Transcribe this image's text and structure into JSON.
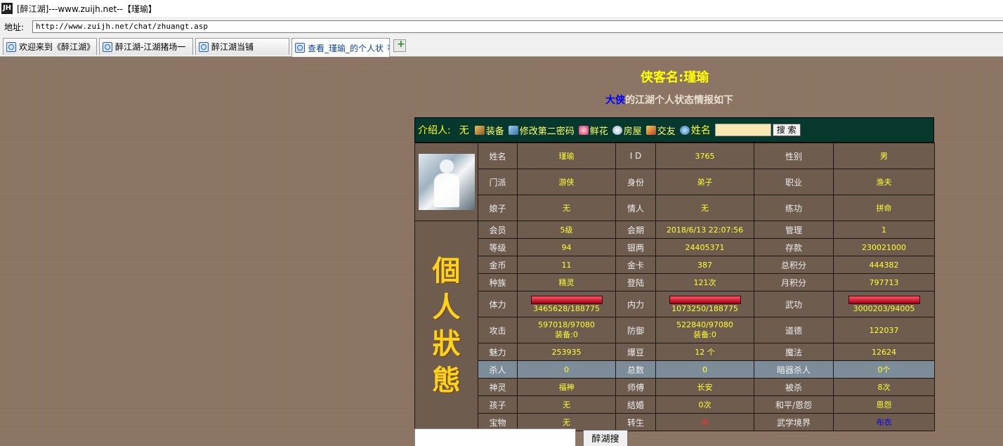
{
  "window": {
    "title": "[醉江湖]---www.zuijh.net--【瑾瑜】",
    "logo": "zuijh-logo"
  },
  "address": {
    "label": "地址:",
    "url": "http://www.zuijh.net/chat/zhuangt.asp"
  },
  "tabs": [
    {
      "label": "欢迎来到《醉江湖》"
    },
    {
      "label": "醉江湖-江湖猪场一"
    },
    {
      "label": "醉江湖当铺"
    },
    {
      "label": "查看_瑾瑜_的个人状"
    }
  ],
  "page": {
    "hero_name": "侠客名:瑾瑜",
    "subtitle_highlight": "大侠",
    "subtitle_rest": "的江湖个人状态情报如下",
    "toolbar": {
      "intro_label": "介绍人:",
      "intro_value": "无",
      "equip": "装备",
      "change_pwd": "修改第二密码",
      "flower": "鲜花",
      "house": "房屋",
      "friend": "交友",
      "name_label": "姓名",
      "search_button": "搜 索"
    },
    "status_chars": [
      "個",
      "人",
      "狀",
      "態"
    ],
    "rows": [
      {
        "c": [
          [
            "姓名",
            "瑾瑜"
          ],
          [
            "I D",
            "3765"
          ],
          [
            "性别",
            "男"
          ]
        ]
      },
      {
        "c": [
          [
            "门派",
            "游侠"
          ],
          [
            "身份",
            "弟子"
          ],
          [
            "职业",
            "渔夫"
          ]
        ]
      },
      {
        "c": [
          [
            "娘子",
            "无"
          ],
          [
            "情人",
            "无"
          ],
          [
            "练功",
            "拼命"
          ]
        ]
      },
      {
        "c": [
          [
            "会员",
            "5级"
          ],
          [
            "会期",
            "2018/6/13 22:07:56"
          ],
          [
            "管理",
            "1"
          ]
        ]
      },
      {
        "c": [
          [
            "等级",
            "94"
          ],
          [
            "银两",
            "24405371"
          ],
          [
            "存款",
            "230021000"
          ]
        ]
      },
      {
        "c": [
          [
            "金币",
            "11"
          ],
          [
            "金卡",
            "387"
          ],
          [
            "总积分",
            "444382"
          ]
        ]
      },
      {
        "c": [
          [
            "种族",
            "精灵"
          ],
          [
            "登陆",
            "121次"
          ],
          [
            "月积分",
            "797713"
          ]
        ]
      },
      {
        "c": [
          [
            "体力",
            "3465628/188775"
          ],
          [
            "内力",
            "1073250/188775"
          ],
          [
            "武功",
            "3000203/94005"
          ]
        ]
      },
      {
        "c": [
          [
            "攻击",
            "597018/97080",
            "装备:0"
          ],
          [
            "防御",
            "522840/97080",
            "装备:0"
          ],
          [
            "道德",
            "122037"
          ]
        ]
      },
      {
        "c": [
          [
            "魅力",
            "253935"
          ],
          [
            "爆豆",
            "12 个"
          ],
          [
            "魔法",
            "12624"
          ]
        ]
      },
      {
        "c": [
          [
            "杀人",
            "0"
          ],
          [
            "总数",
            "0"
          ],
          [
            "暗器杀人",
            "0个"
          ]
        ]
      },
      {
        "c": [
          [
            "神灵",
            "福神"
          ],
          [
            "师傅",
            "长安"
          ],
          [
            "被杀",
            "8次"
          ]
        ]
      },
      {
        "c": [
          [
            "孩子",
            "无"
          ],
          [
            "结婚",
            "0次"
          ],
          [
            "和平/恩怨",
            "恩怨"
          ]
        ]
      },
      {
        "c": [
          [
            "宝物",
            "无"
          ],
          [
            "转生",
            "次"
          ],
          [
            "武学境界",
            "布衣"
          ]
        ]
      }
    ],
    "bottom_button": "醉湖搜索"
  },
  "colors": {
    "value_text": "#ffff33",
    "highlight_blue": "#0000ff",
    "toolbar_bg": "#07382e"
  }
}
